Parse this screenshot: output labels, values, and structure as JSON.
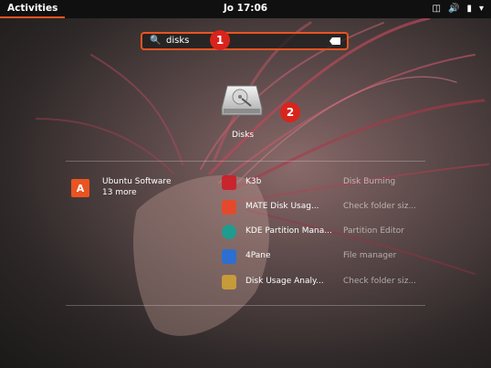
{
  "topbar": {
    "activities": "Activities",
    "clock": "Jo 17:06",
    "tray": {
      "network_icon": "network-icon",
      "volume_icon": "volume-icon",
      "battery_icon": "battery-icon",
      "menu_icon": "chevron-down-icon"
    }
  },
  "search": {
    "query": "disks",
    "search_icon": "search-icon",
    "clear_icon": "clear-backspace-icon"
  },
  "callouts": [
    "1",
    "2"
  ],
  "app_grid": [
    {
      "label": "Disks",
      "icon": "disks-icon"
    }
  ],
  "provider": {
    "name": "Ubuntu Software",
    "more": "13 more",
    "icon": "ubuntu-software-icon"
  },
  "results": [
    {
      "name": "K3b",
      "description": "Disk Burning",
      "icon": "k3b-icon",
      "color": "#c8252c"
    },
    {
      "name": "MATE Disk Usag...",
      "description": "Check folder siz...",
      "icon": "mate-disk-usage-icon",
      "color": "#e34a2b"
    },
    {
      "name": "KDE Partition Mana...",
      "description": "Partition Editor",
      "icon": "kde-partition-manager-icon",
      "color": "#1f9c8f"
    },
    {
      "name": "4Pane",
      "description": "File manager",
      "icon": "4pane-icon",
      "color": "#2c6fd1"
    },
    {
      "name": "Disk Usage Analy...",
      "description": "Check folder siz...",
      "icon": "disk-usage-analyzer-icon",
      "color": "#c79a3a"
    }
  ],
  "colors": {
    "accent": "#e95420",
    "callout": "#d9241c",
    "topbar": "#101010"
  }
}
